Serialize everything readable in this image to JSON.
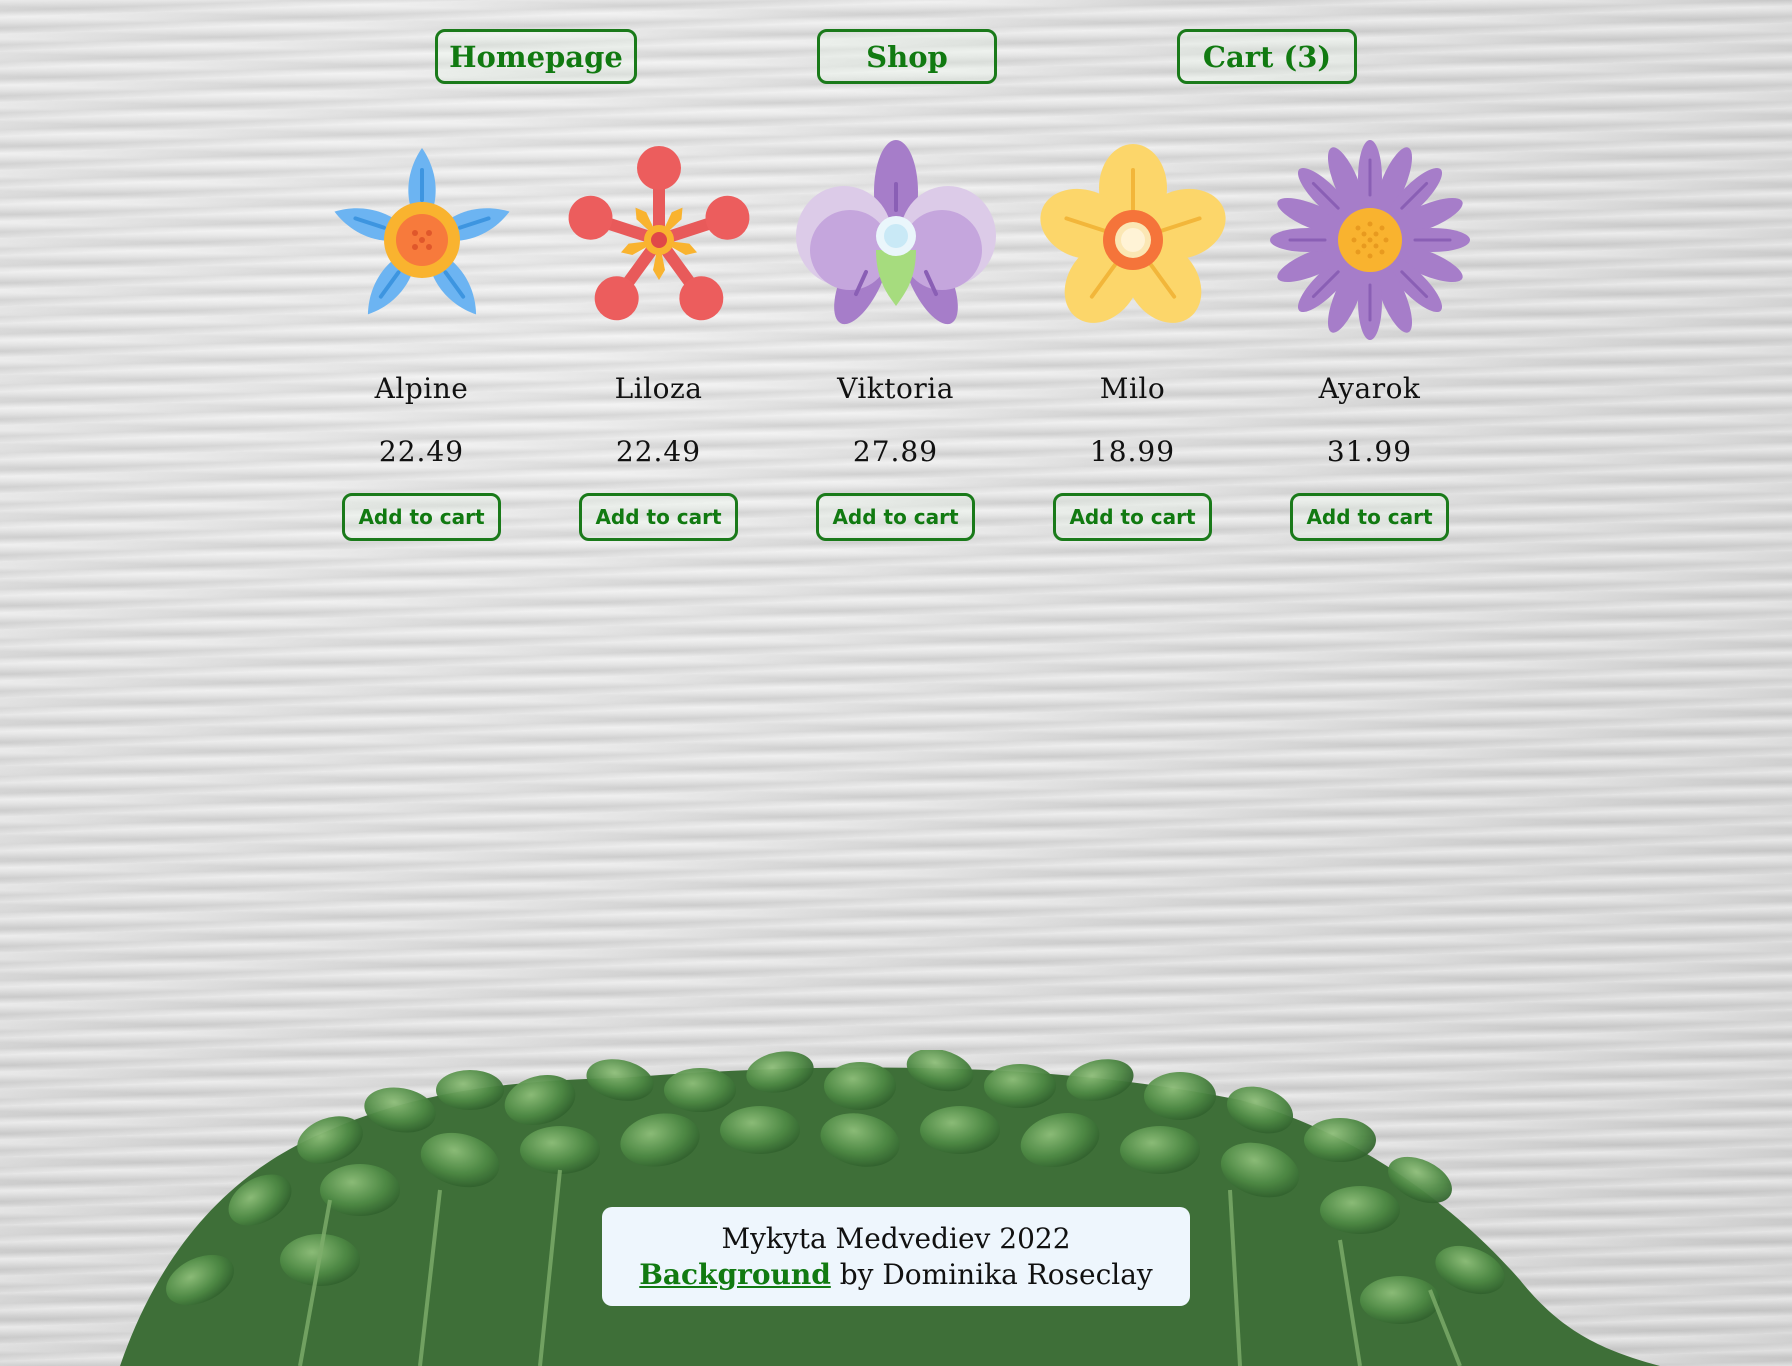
{
  "nav": {
    "homepage_label": "Homepage",
    "shop_label": "Shop",
    "cart_label": "Cart (3)"
  },
  "products": [
    {
      "name": "Alpine",
      "price": "22.49",
      "button": "Add to cart",
      "icon": "blue-flower-icon"
    },
    {
      "name": "Liloza",
      "price": "22.49",
      "button": "Add to cart",
      "icon": "red-flower-icon"
    },
    {
      "name": "Viktoria",
      "price": "27.89",
      "button": "Add to cart",
      "icon": "purple-orchid-icon"
    },
    {
      "name": "Milo",
      "price": "18.99",
      "button": "Add to cart",
      "icon": "yellow-flower-icon"
    },
    {
      "name": "Ayarok",
      "price": "31.99",
      "button": "Add to cart",
      "icon": "purple-daisy-icon"
    }
  ],
  "footer": {
    "author": "Mykyta Medvediev 2022",
    "link_label": "Background",
    "credit": "by Dominika Roseclay"
  },
  "colors": {
    "accent_green": "#117a11",
    "footer_bg": "#eef6fd"
  }
}
